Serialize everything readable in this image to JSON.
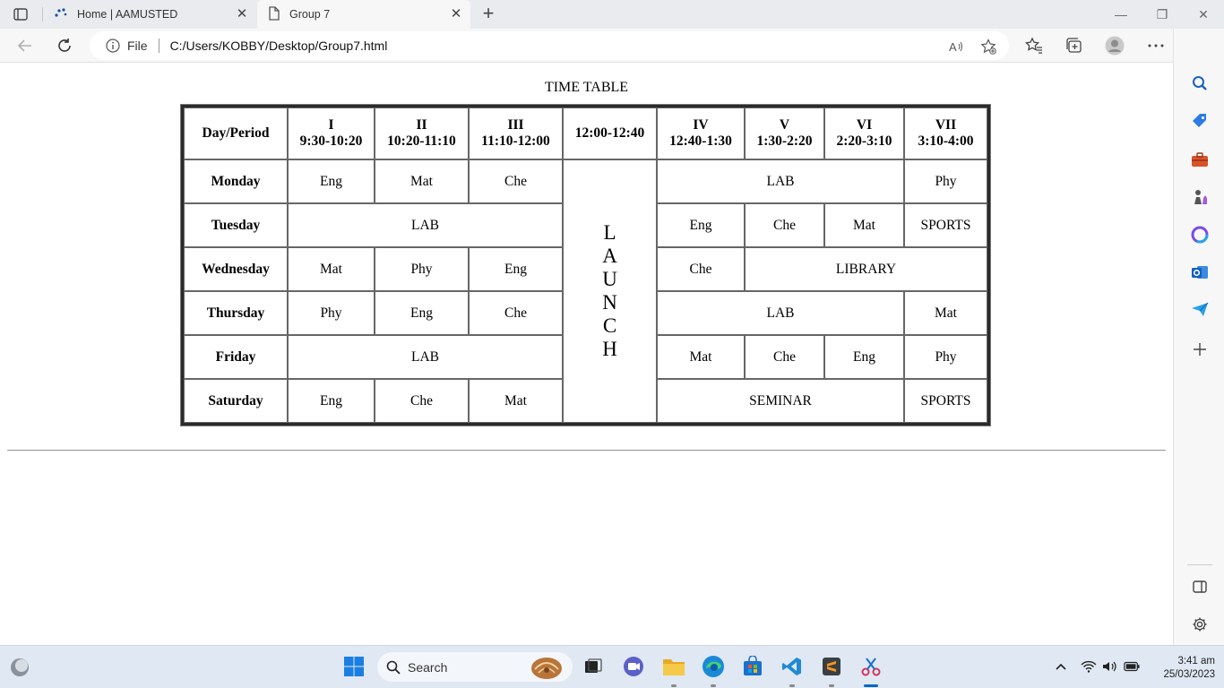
{
  "browser": {
    "tabs": [
      {
        "title": "Home | AAMUSTED"
      },
      {
        "title": "Group 7"
      }
    ],
    "address": {
      "scheme_label": "File",
      "url": "C:/Users/KOBBY/Desktop/Group7.html"
    }
  },
  "page": {
    "caption": "TIME TABLE",
    "header": {
      "day_period": "Day/Period",
      "periods": [
        {
          "num": "I",
          "time": "9:30-10:20"
        },
        {
          "num": "II",
          "time": "10:20-11:10"
        },
        {
          "num": "III",
          "time": "11:10-12:00"
        },
        {
          "num": "",
          "time": "12:00-12:40"
        },
        {
          "num": "IV",
          "time": "12:40-1:30"
        },
        {
          "num": "V",
          "time": "1:30-2:20"
        },
        {
          "num": "VI",
          "time": "2:20-3:10"
        },
        {
          "num": "VII",
          "time": "3:10-4:00"
        }
      ]
    },
    "lunch_letters": [
      "L",
      "A",
      "U",
      "N",
      "C",
      "H"
    ],
    "rows": [
      {
        "day": "Monday",
        "cells": [
          "Eng",
          "Mat",
          "Che",
          "LAB",
          "Phy"
        ]
      },
      {
        "day": "Tuesday",
        "cells": [
          "LAB",
          "Eng",
          "Che",
          "Mat",
          "SPORTS"
        ]
      },
      {
        "day": "Wednesday",
        "cells": [
          "Mat",
          "Phy",
          "Eng",
          "Che",
          "LIBRARY"
        ]
      },
      {
        "day": "Thursday",
        "cells": [
          "Phy",
          "Eng",
          "Che",
          "LAB",
          "Mat"
        ]
      },
      {
        "day": "Friday",
        "cells": [
          "LAB",
          "Mat",
          "Che",
          "Eng",
          "Phy"
        ]
      },
      {
        "day": "Saturday",
        "cells": [
          "Eng",
          "Che",
          "Mat",
          "SEMINAR",
          "SPORTS"
        ]
      }
    ]
  },
  "taskbar": {
    "search_label": "Search",
    "time": "3:41 am",
    "date": "25/03/2023"
  },
  "colors": {
    "accent": "#0a64c8",
    "taskbar_bg": "#dfe8f3"
  }
}
